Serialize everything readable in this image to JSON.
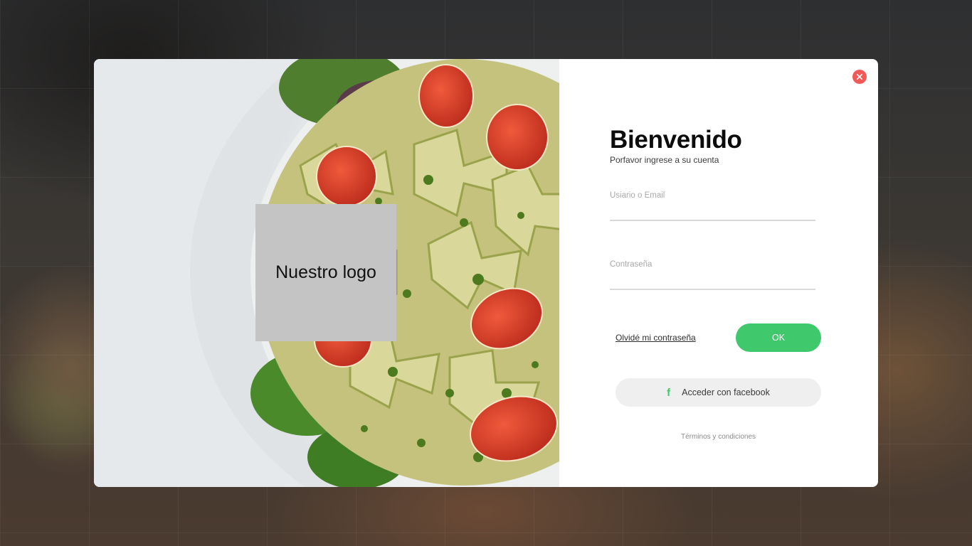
{
  "logo": {
    "text": "Nuestro logo"
  },
  "form": {
    "title": "Bienvenido",
    "subtitle": "Porfavor ingrese a su cuenta",
    "username_label": "Usiario o Email",
    "username_value": "",
    "password_label": "Contraseña",
    "password_value": "",
    "forgot_label": "Olvidé mi contraseña",
    "ok_label": "OK",
    "facebook_label": "Acceder con facebook",
    "terms_label": "Términos y condiciones"
  },
  "icons": {
    "close": "close-icon",
    "facebook": "facebook-icon"
  },
  "colors": {
    "accent_green": "#3fc86c",
    "close_red": "#f25a5a",
    "logo_placeholder": "#c4c4c4"
  }
}
